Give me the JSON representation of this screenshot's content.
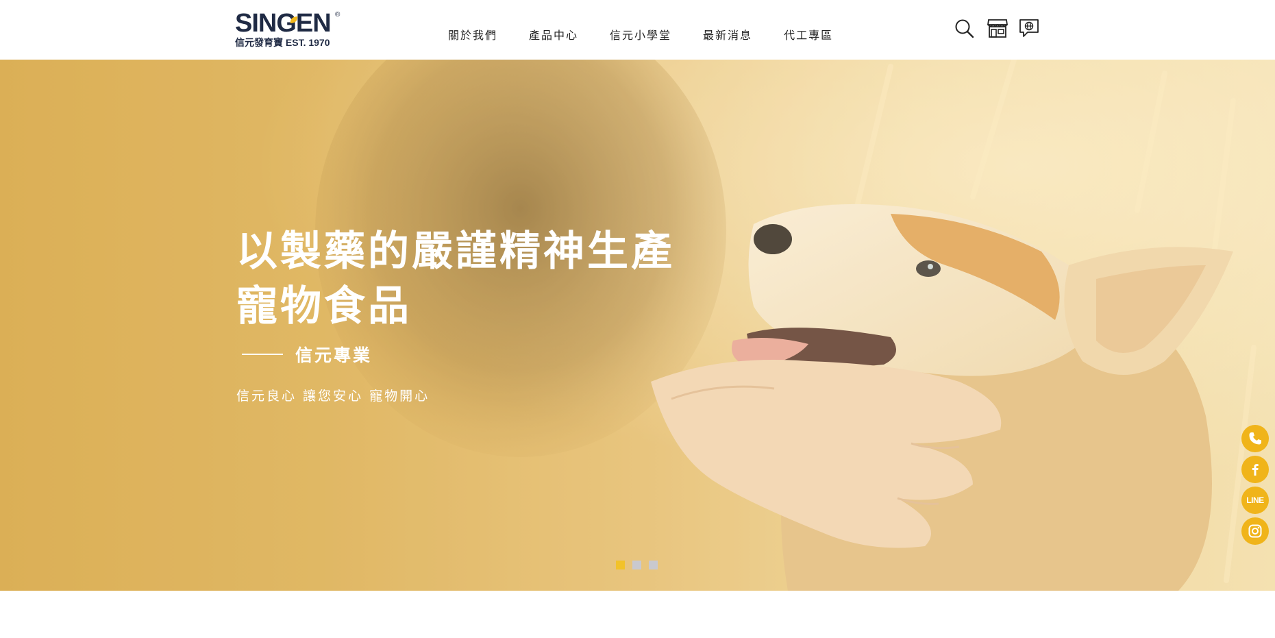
{
  "brand": {
    "name": "SINGEN",
    "registered": "®",
    "sub": "信元發育寶 EST. 1970"
  },
  "nav": {
    "items": [
      {
        "label": "關於我們"
      },
      {
        "label": "產品中心"
      },
      {
        "label": "信元小學堂"
      },
      {
        "label": "最新消息"
      },
      {
        "label": "代工專區"
      }
    ]
  },
  "header_icons": [
    "search-icon",
    "store-icon",
    "language-icon"
  ],
  "hero": {
    "title_line1": "以製藥的嚴謹精神生產",
    "title_line2": "寵物食品",
    "subtitle": "信元專業",
    "tagline": "信元良心 讓您安心 寵物開心",
    "slides_total": 3,
    "active_slide": 1
  },
  "social": {
    "items": [
      "phone-icon",
      "facebook-icon",
      "line-icon",
      "instagram-icon"
    ],
    "line_label": "LINE"
  },
  "colors": {
    "accent": "#f0b41a",
    "brand_navy": "#1f2a44",
    "dot_inactive": "#c9c9cf",
    "dot_active": "#f2c22a"
  }
}
